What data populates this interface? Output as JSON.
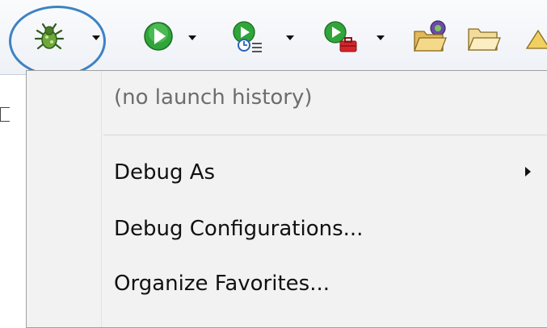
{
  "toolbar": {
    "buttons": [
      {
        "icon": "debug-bug-icon",
        "has_dropdown": true
      },
      {
        "icon": "run-play-icon",
        "has_dropdown": true
      },
      {
        "icon": "coverage-run-icon",
        "has_dropdown": true
      },
      {
        "icon": "external-tools-run-icon",
        "has_dropdown": true
      },
      {
        "icon": "open-folder-icon",
        "has_dropdown": false
      },
      {
        "icon": "folder-icon",
        "has_dropdown": false
      }
    ],
    "highlight_color": "#3d82c4"
  },
  "menu": {
    "history_label": "(no launch history)",
    "items": [
      {
        "label": "Debug As",
        "has_submenu": true
      },
      {
        "label": "Debug Configurations..."
      },
      {
        "label": "Organize Favorites..."
      }
    ]
  }
}
